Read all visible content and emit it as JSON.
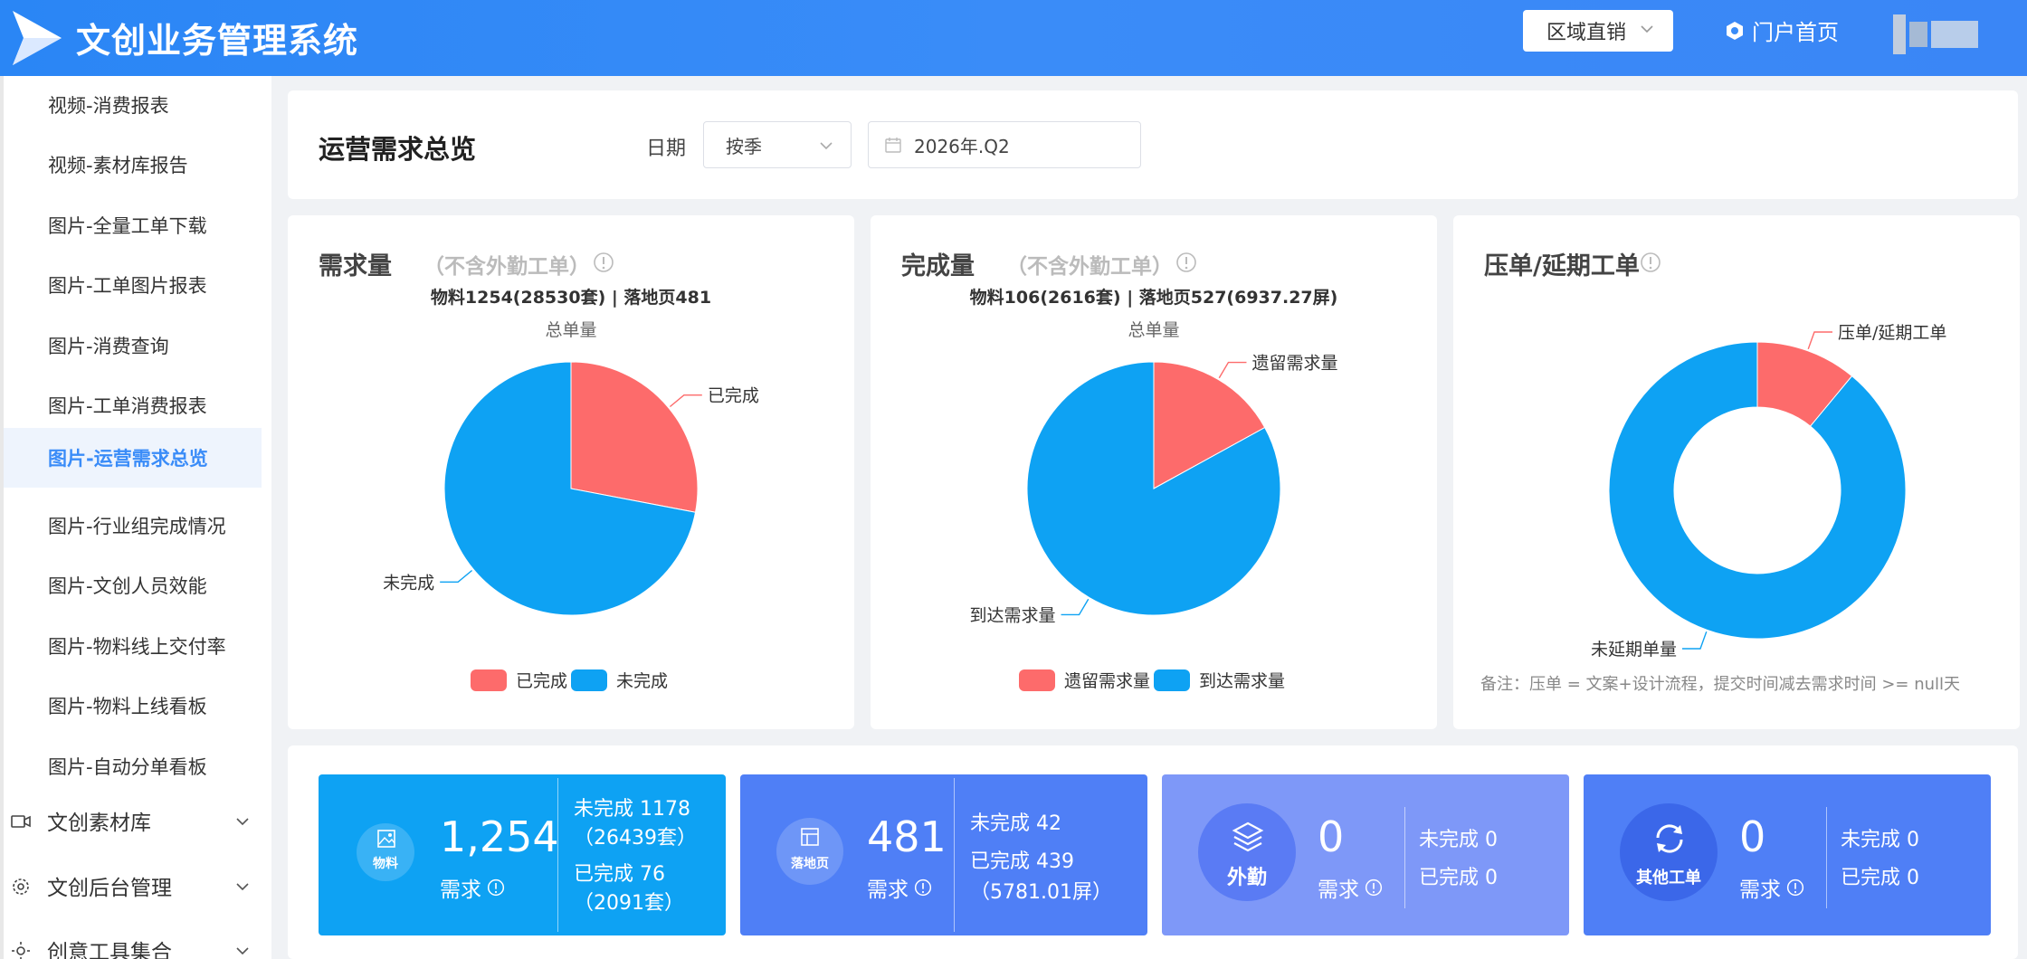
{
  "header": {
    "app_title": "文创业务管理系统",
    "region_select": "区域直销",
    "portal_link": "门户首页"
  },
  "sidebar": {
    "items": [
      {
        "label": "视频-消费报表"
      },
      {
        "label": "视频-素材库报告"
      },
      {
        "label": "图片-全量工单下载"
      },
      {
        "label": "图片-工单图片报表"
      },
      {
        "label": "图片-消费查询"
      },
      {
        "label": "图片-工单消费报表"
      },
      {
        "label": "图片-运营需求总览",
        "active": true
      },
      {
        "label": "图片-行业组完成情况"
      },
      {
        "label": "图片-文创人员效能"
      },
      {
        "label": "图片-物料线上交付率"
      },
      {
        "label": "图片-物料上线看板"
      },
      {
        "label": "图片-自动分单看板"
      }
    ],
    "groups": [
      {
        "label": "文创素材库",
        "icon": "video-icon"
      },
      {
        "label": "文创后台管理",
        "icon": "gear-icon"
      },
      {
        "label": "创意工具集合",
        "icon": "sun-icon"
      }
    ]
  },
  "filter": {
    "page_title": "运营需求总览",
    "date_label": "日期",
    "period_value": "按季",
    "date_value": "2026年.Q2"
  },
  "chart_data": [
    {
      "type": "pie",
      "title": "需求量",
      "note": "（不含外勤工单）",
      "subtitle": "物料1254(28530套) | 落地页481",
      "caption": "总单量",
      "labels": [
        "已完成",
        "未完成"
      ],
      "values": [
        28,
        72
      ],
      "colors": [
        "#fd6b6b",
        "#0ea2f3"
      ],
      "legend": "bottom"
    },
    {
      "type": "pie",
      "title": "完成量",
      "note": "（不含外勤工单）",
      "subtitle": "物料106(2616套) | 落地页527(6937.27屏)",
      "caption": "总单量",
      "labels": [
        "遗留需求量",
        "到达需求量"
      ],
      "values": [
        17,
        83
      ],
      "colors": [
        "#fd6b6b",
        "#0ea2f3"
      ],
      "legend": "bottom"
    },
    {
      "type": "pie",
      "title": "压单/延期工单",
      "labels": [
        "压单/延期工单",
        "未延期单量"
      ],
      "values": [
        11,
        89
      ],
      "colors": [
        "#fd6b6b",
        "#0ea2f3"
      ],
      "donut": true,
      "remark": "备注：压单 = 文案+设计流程，提交时间减去需求时间 >= null天"
    }
  ],
  "stats": [
    {
      "circle_text": "物料",
      "icon": "image-icon",
      "color": "#0ea2f3",
      "number": "1,254",
      "label": "需求",
      "lines": [
        "未完成 1178",
        "（26439套）",
        "已完成 76",
        "（2091套）"
      ]
    },
    {
      "circle_text": "落地页",
      "icon": "layout-icon",
      "color": "#4f7ff6",
      "number": "481",
      "label": "需求",
      "lines": [
        "未完成 42",
        "已完成 439",
        "（5781.01屏）"
      ]
    },
    {
      "circle_text": "外勤",
      "icon": "layers-icon",
      "color": "#7e98f8",
      "number": "0",
      "label": "需求",
      "lines": [
        "未完成 0",
        "已完成 0"
      ]
    },
    {
      "circle_text": "其他工单",
      "icon": "refresh-icon",
      "color": "#4f7ff6",
      "number": "0",
      "label": "需求",
      "lines": [
        "未完成 0",
        "已完成 0"
      ]
    }
  ]
}
